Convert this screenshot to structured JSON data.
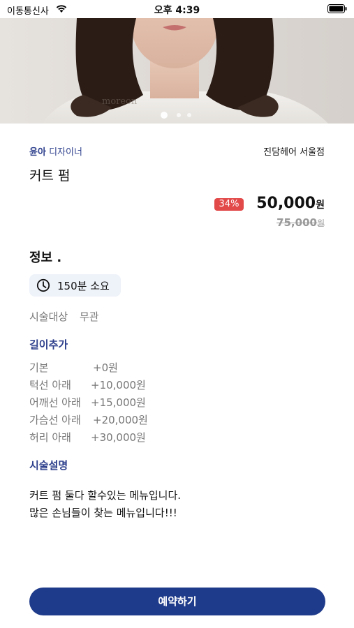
{
  "status_bar": {
    "carrier": "이동통신사",
    "time": "오후 4:39"
  },
  "hero": {
    "watermark": "moreon",
    "page_count": 3,
    "current_page": 1
  },
  "designer": {
    "name": "윤아",
    "role": "디자이너"
  },
  "salon": "진담헤어 서울점",
  "menu_title": "커트 펌",
  "pricing": {
    "discount": "34%",
    "price": "50,000",
    "price_unit": "원",
    "original_price": "75,000",
    "original_unit": "원"
  },
  "info": {
    "heading": "정보 .",
    "duration": "150분 소요",
    "target_label": "시술대상",
    "target_value": "무관"
  },
  "length_extra": {
    "heading": "길이추가",
    "items": [
      {
        "name": "기본",
        "price": "+0원"
      },
      {
        "name": "턱선 아래",
        "price": "+10,000원"
      },
      {
        "name": "어깨선 아래",
        "price": "+15,000원"
      },
      {
        "name": "가슴선 아래",
        "price": "+20,000원"
      },
      {
        "name": "허리 아래",
        "price": "+30,000원"
      }
    ]
  },
  "description": {
    "heading": "시술설명",
    "lines": [
      "커트 펌 둘다 할수있는 메뉴입니다.",
      "많은 손님들이 찾는 메뉴입니다!!!"
    ]
  },
  "reserve_button": "예약하기",
  "colors": {
    "accent": "#1e3a8a",
    "heading_blue": "#2d3f8c",
    "discount_red": "#e24949"
  }
}
